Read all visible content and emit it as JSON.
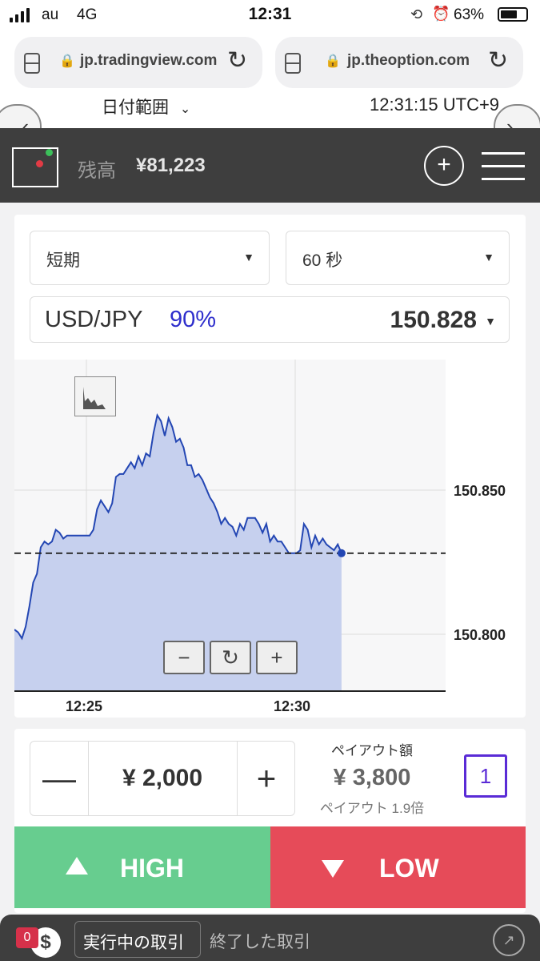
{
  "status_bar": {
    "carrier": "au",
    "network": "4G",
    "time": "12:31",
    "battery": "63%"
  },
  "browser_tabs": [
    {
      "url": "jp.tradingview.com"
    },
    {
      "url": "jp.theoption.com"
    }
  ],
  "date_header": {
    "range_label": "日付範囲",
    "clock": "12:31:15 UTC+9"
  },
  "header": {
    "balance_label": "残高",
    "balance_value": "¥81,223"
  },
  "selectors": {
    "trade_type": "短期",
    "duration": "60 秒"
  },
  "asset": {
    "pair": "USD/JPY",
    "payout_percent": "90%",
    "price": "150.828"
  },
  "chart_data": {
    "type": "area",
    "x_ticks": [
      "12:25",
      "12:30"
    ],
    "y_ticks": [
      "150.850",
      "150.800"
    ],
    "ylim": [
      150.781,
      150.894
    ],
    "current_price": 150.828,
    "series": [
      {
        "values": [
          150.802,
          150.801,
          150.799,
          150.803,
          150.81,
          150.818,
          150.821,
          150.83,
          150.832,
          150.831,
          150.832,
          150.836,
          150.835,
          150.833,
          150.834,
          150.834,
          150.834,
          150.834,
          150.834,
          150.834,
          150.834,
          150.836,
          150.843,
          150.846,
          150.844,
          150.842,
          150.845,
          150.854,
          150.855,
          150.855,
          150.857,
          150.859,
          150.857,
          150.861,
          150.858,
          150.862,
          150.861,
          150.869,
          150.875,
          150.873,
          150.868,
          150.874,
          150.871,
          150.866,
          150.867,
          150.864,
          150.858,
          150.858,
          150.854,
          150.855,
          150.853,
          150.85,
          150.847,
          150.845,
          150.842,
          150.838,
          150.84,
          150.838,
          150.837,
          150.834,
          150.838,
          150.836,
          150.84,
          150.84,
          150.84,
          150.838,
          150.835,
          150.838,
          150.832,
          150.834,
          150.832,
          150.832,
          150.83,
          150.828,
          150.828,
          150.828,
          150.829,
          150.838,
          150.836,
          150.83,
          150.834,
          150.831,
          150.833,
          150.831,
          150.83,
          150.829,
          150.831,
          150.828
        ]
      }
    ]
  },
  "zoom_controls": {
    "zoom_out": "−",
    "reset": "↻",
    "zoom_in": "+"
  },
  "trade": {
    "amount": "¥ 2,000",
    "minus": "—",
    "plus": "+",
    "payout_label": "ペイアウト額",
    "payout_value": "¥ 3,800",
    "payout_rate": "ペイアウト 1.9倍",
    "lot_badge": "1"
  },
  "actions": {
    "high": "HIGH",
    "low": "LOW"
  },
  "bottom_bar": {
    "count": "0",
    "active_tab": "実行中の取引",
    "closed_tab": "終了した取引"
  }
}
